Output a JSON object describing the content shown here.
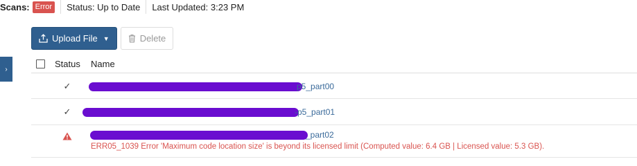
{
  "topbar": {
    "scans_label": "Scans:",
    "scans_badge": "Error",
    "status_text": "Status: Up to Date",
    "last_updated_text": "Last Updated: 3:23 PM"
  },
  "side_tab": {
    "icon": "chevron-right-icon",
    "glyph": "›"
  },
  "toolbar": {
    "upload_label": "Upload File",
    "upload_icon": "upload-icon",
    "delete_label": "Delete",
    "delete_icon": "trash-icon"
  },
  "table": {
    "columns": [
      "Status",
      "Name"
    ],
    "rows": [
      {
        "status": "check-icon",
        "status_glyph": "✓",
        "name_suffix": "p5_part00"
      },
      {
        "status": "check-icon",
        "status_glyph": "✓",
        "name_suffix": "-p5_part01"
      },
      {
        "status": "warning-icon",
        "name_suffix": "_part02",
        "error": "ERR05_1039 Error 'Maximum code location size' is beyond its licensed limit (Computed value: 6.4 GB | Licensed value: 5.3 GB)."
      }
    ]
  },
  "colors": {
    "primary": "#2f5f8f",
    "error": "#d9534f",
    "link": "#3a6a9a",
    "redaction": "#6a0dd0"
  }
}
